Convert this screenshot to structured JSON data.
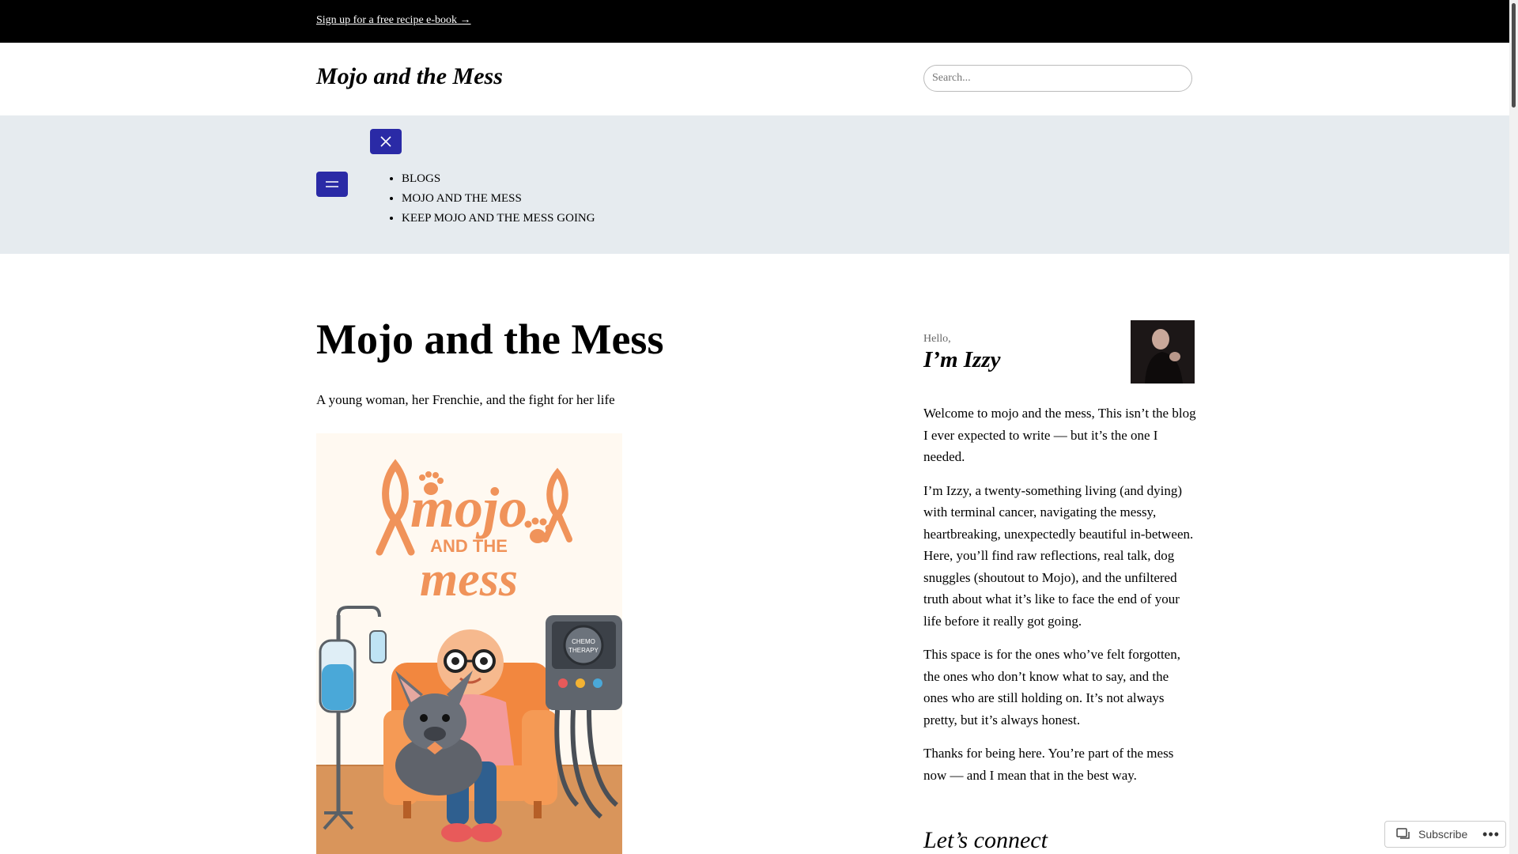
{
  "topbar": {
    "link": "Sign up for a free recipe e-book →"
  },
  "header": {
    "site_title": "Mojo and the Mess",
    "search_placeholder": "Search..."
  },
  "nav": {
    "items": [
      "BLOGS",
      "MOJO AND THE MESS",
      "KEEP MOJO AND THE MESS GOING"
    ],
    "accent": "#2a2aa6",
    "band_color": "#e6ebef"
  },
  "main": {
    "title": "Mojo and the Mess",
    "tagline": "A young woman, her Frenchie, and the fight for her life",
    "hero": {
      "title_line1": "mojo",
      "title_line2": "AND THE",
      "title_line3": "mess",
      "machine_label_1": "CHEMO",
      "machine_label_2": "THERAPY",
      "accent": "#f0935a"
    }
  },
  "sidebar": {
    "hello": "Hello,",
    "name": "I’m Izzy",
    "bio": [
      "Welcome to mojo and the mess, This isn’t the blog I ever expected to write — but it’s the one I needed.",
      "I’m Izzy, a twenty-something living (and dying) with terminal cancer, navigating the messy, heartbreaking, unexpectedly beautiful in-between. Here, you’ll find raw reflections, real talk, dog snuggles (shoutout to Mojo), and the unfiltered truth about what it’s like to face the end of your life before it really got going.",
      "This space is for the ones who’ve felt forgotten, the ones who don’t know what to say, and the ones who are still holding on. It’s not always pretty, but it’s always honest.",
      "Thanks for being here. You’re part of the mess now — and I mean that in the best way."
    ],
    "connect": "Let’s connect"
  },
  "subscribe": {
    "label": "Subscribe",
    "more": "•••"
  }
}
